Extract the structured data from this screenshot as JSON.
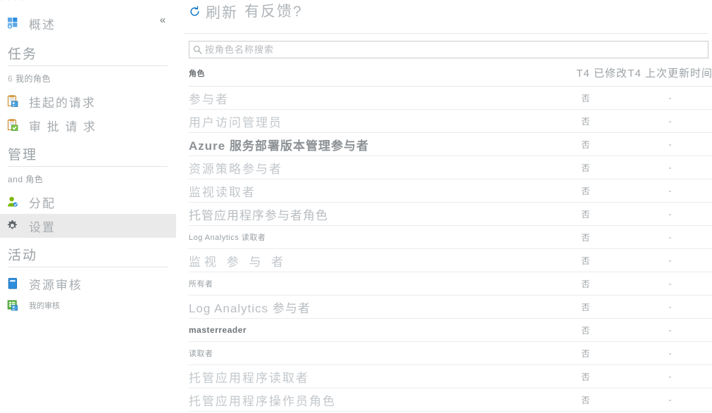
{
  "window": {
    "ghost_top_text": "· · · ·"
  },
  "sidebar": {
    "collapse_icon": "chevron-double-left",
    "overview": {
      "label": "概述",
      "icon": "grid-dashboard-icon"
    },
    "groups": [
      {
        "header": "任务",
        "sub_label": "我的角色",
        "sub_count": "6",
        "items": [
          {
            "label": "挂起的请求",
            "icon": "clipboard-pending-icon",
            "size": "large",
            "selected": false
          },
          {
            "label": "审 批 请 求",
            "icon": "clipboard-approve-icon",
            "size": "large",
            "selected": false
          }
        ]
      },
      {
        "header": "管理",
        "sub_label": "and 角色",
        "sub_count": "",
        "items": [
          {
            "label": "分配",
            "icon": "user-assign-icon",
            "size": "large",
            "selected": false
          },
          {
            "label": "设置",
            "icon": "gear-icon",
            "size": "large",
            "selected": true
          }
        ]
      },
      {
        "header": "活动",
        "sub_label": "",
        "sub_count": "",
        "items": [
          {
            "label": "资源审核",
            "icon": "book-resource-icon",
            "size": "large",
            "selected": false
          },
          {
            "label": "我的审核",
            "icon": "spreadsheet-review-icon",
            "size": "small",
            "selected": false
          }
        ]
      }
    ]
  },
  "toolbar": {
    "refresh_label": "刷新",
    "refresh_icon": "refresh-icon",
    "feedback_label": "有反馈?"
  },
  "search": {
    "placeholder": "按角色名称搜索",
    "value": "",
    "icon": "search-icon"
  },
  "table": {
    "columns": {
      "name": "角色",
      "modified": "T4 已修改",
      "updated": "T4 上次更新时间"
    },
    "rows": [
      {
        "name": "参与者",
        "style": "v-lg",
        "modified": "否",
        "updated": "-"
      },
      {
        "name": "用户访问管理员",
        "style": "v-lg",
        "modified": "否",
        "updated": "-"
      },
      {
        "name": "Azure 服务部署版本管理参与者",
        "style": "v-bold",
        "modified": "否",
        "updated": "-"
      },
      {
        "name": "资源策略参与者",
        "style": "v-lg",
        "modified": "否",
        "updated": "-"
      },
      {
        "name": "监视读取者",
        "style": "v-lg",
        "modified": "否",
        "updated": "-"
      },
      {
        "name": "托管应用程序参与者角色",
        "style": "v-md",
        "modified": "否",
        "updated": "-"
      },
      {
        "name": "Log Analytics 读取者",
        "style": "v-sm",
        "modified": "否",
        "updated": "-"
      },
      {
        "name": "监视 参 与 者",
        "style": "v-sp",
        "modified": "否",
        "updated": "-"
      },
      {
        "name": "所有者",
        "style": "v-sm",
        "modified": "否",
        "updated": "-"
      },
      {
        "name": "Log Analytics 参与者",
        "style": "v-md",
        "modified": "否",
        "updated": "-"
      },
      {
        "name": "masterreader",
        "style": "v-smb",
        "modified": "否",
        "updated": "-"
      },
      {
        "name": "读取者",
        "style": "v-sm",
        "modified": "否",
        "updated": "-"
      },
      {
        "name": "托管应用程序读取者",
        "style": "v-lg",
        "modified": "否",
        "updated": "-"
      },
      {
        "name": "托管应用程序操作员角色",
        "style": "v-lg",
        "modified": "否",
        "updated": "-"
      }
    ]
  },
  "colors": {
    "accent_blue": "#0072c6",
    "selected_row_bg": "#eaeaea",
    "icon_green": "#7ab800",
    "text_muted": "#a6abaf"
  }
}
